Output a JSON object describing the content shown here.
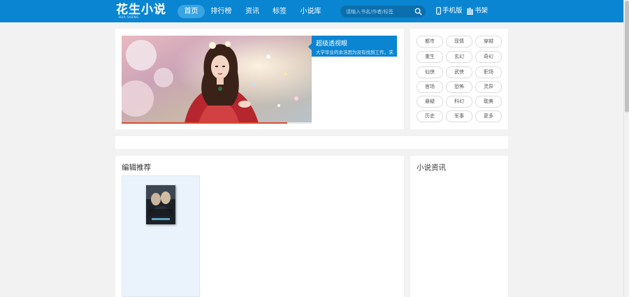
{
  "header": {
    "logo": "花生小说",
    "logo_sub": "HUA SHENG",
    "nav": [
      {
        "label": "首页",
        "active": true
      },
      {
        "label": "排行榜",
        "active": false
      },
      {
        "label": "资讯",
        "active": false
      },
      {
        "label": "标签",
        "active": false
      },
      {
        "label": "小说库",
        "active": false
      }
    ],
    "search_placeholder": "请输入书名/作者/标签",
    "mobile_label": "手机版",
    "shelf_label": "书架"
  },
  "banner": {
    "title": "超级透视眼",
    "description": "大学毕业的余浩因为没有找到工作，求...",
    "progress": 0.87
  },
  "tags": [
    "都市",
    "现情",
    "穿越",
    "重生",
    "玄幻",
    "奇幻",
    "仙侠",
    "武侠",
    "职场",
    "官场",
    "恐怖",
    "灵异",
    "悬疑",
    "科幻",
    "耽美",
    "历史",
    "军事",
    "更多"
  ],
  "recommend": {
    "title": "编辑推荐",
    "book_cover_text": "超级透视眼"
  },
  "news": {
    "title": "小说资讯"
  },
  "colors": {
    "header_bg": "#0a85d1",
    "accent": "#0a85d1",
    "page_bg": "#f2f2f2"
  }
}
